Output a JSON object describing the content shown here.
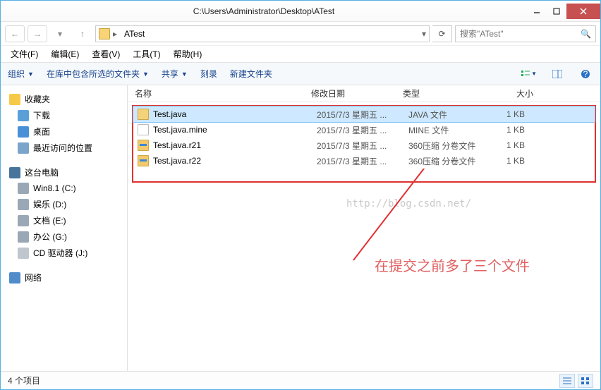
{
  "window": {
    "title": "C:\\Users\\Administrator\\Desktop\\ATest"
  },
  "breadcrumb": {
    "folder": "ATest",
    "search_placeholder": "搜索\"ATest\""
  },
  "menu": {
    "file": "文件(F)",
    "edit": "编辑(E)",
    "view": "查看(V)",
    "tools": "工具(T)",
    "help": "帮助(H)"
  },
  "toolbar": {
    "organize": "组织",
    "include": "在库中包含所选的文件夹",
    "share": "共享",
    "burn": "刻录",
    "newfolder": "新建文件夹"
  },
  "sidebar": {
    "favorites": "收藏夹",
    "downloads": "下载",
    "desktop": "桌面",
    "recent": "最近访问的位置",
    "thispc": "这台电脑",
    "drives": [
      "Win8.1 (C:)",
      "娱乐 (D:)",
      "文档 (E:)",
      "办公 (G:)",
      "CD 驱动器 (J:)"
    ],
    "network": "网络"
  },
  "columns": {
    "name": "名称",
    "date": "修改日期",
    "type": "类型",
    "size": "大小"
  },
  "files": [
    {
      "name": "Test.java",
      "date": "2015/7/3 星期五 ...",
      "type": "JAVA 文件",
      "size": "1 KB",
      "icon": "java",
      "selected": true
    },
    {
      "name": "Test.java.mine",
      "date": "2015/7/3 星期五 ...",
      "type": "MINE 文件",
      "size": "1 KB",
      "icon": "txt",
      "selected": false
    },
    {
      "name": "Test.java.r21",
      "date": "2015/7/3 星期五 ...",
      "type": "360压缩 分卷文件",
      "size": "1 KB",
      "icon": "arc",
      "selected": false
    },
    {
      "name": "Test.java.r22",
      "date": "2015/7/3 星期五 ...",
      "type": "360压缩 分卷文件",
      "size": "1 KB",
      "icon": "arc",
      "selected": false
    }
  ],
  "watermark": "http://blog.csdn.net/",
  "annotation": "在提交之前多了三个文件",
  "status": {
    "count": "4 个项目"
  }
}
